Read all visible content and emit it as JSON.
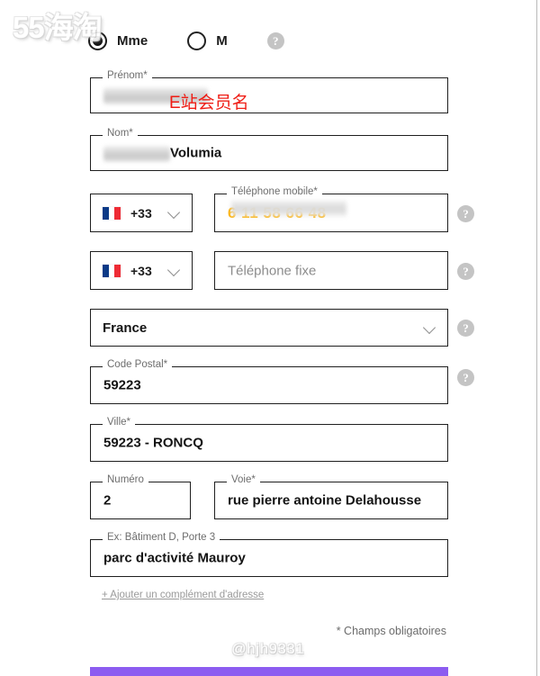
{
  "watermarks": {
    "logo": "55海淘",
    "user": "@hjh9331"
  },
  "annotations": {
    "firstname_note": "E站会员名"
  },
  "gender": {
    "options": [
      {
        "label": "Mme",
        "selected": true
      },
      {
        "label": "M",
        "selected": false
      }
    ],
    "help_icon": "help-icon",
    "help_glyph": "?"
  },
  "fields": {
    "firstname": {
      "label": "Prénom*",
      "value": "",
      "redacted": true
    },
    "lastname": {
      "label": "Nom*",
      "value": "Volumia",
      "redacted": true
    },
    "mobile_country": {
      "dial_code": "+33",
      "flag": "fr-flag-icon"
    },
    "mobile": {
      "label": "Téléphone mobile*",
      "value": "6 11 58 66 48",
      "redacted": true
    },
    "landline_country": {
      "dial_code": "+33",
      "flag": "fr-flag-icon"
    },
    "landline": {
      "label": "",
      "placeholder": "Téléphone fixe",
      "value": ""
    },
    "country": {
      "value": "France"
    },
    "postal_code": {
      "label": "Code Postal*",
      "value": "59223"
    },
    "city": {
      "label": "Ville*",
      "value": "59223 - RONCQ"
    },
    "street_number": {
      "label": "Numéro",
      "value": "2"
    },
    "street": {
      "label": "Voie*",
      "value": "rue pierre antoine Delahousse"
    },
    "complement": {
      "label": "Ex: Bâtiment D, Porte 3",
      "value": "parc d'activité Mauroy"
    }
  },
  "links": {
    "add_address_complement": "+ Ajouter un complément d'adresse"
  },
  "footer": {
    "required_note": "* Champs obligatoires"
  },
  "colors": {
    "accent_purple": "#8c5cf0",
    "annotation_red": "#ef1d15",
    "redacted_amber": "#ffb000",
    "field_border": "#1f1f1f",
    "help_gray": "#c4c4c4"
  }
}
